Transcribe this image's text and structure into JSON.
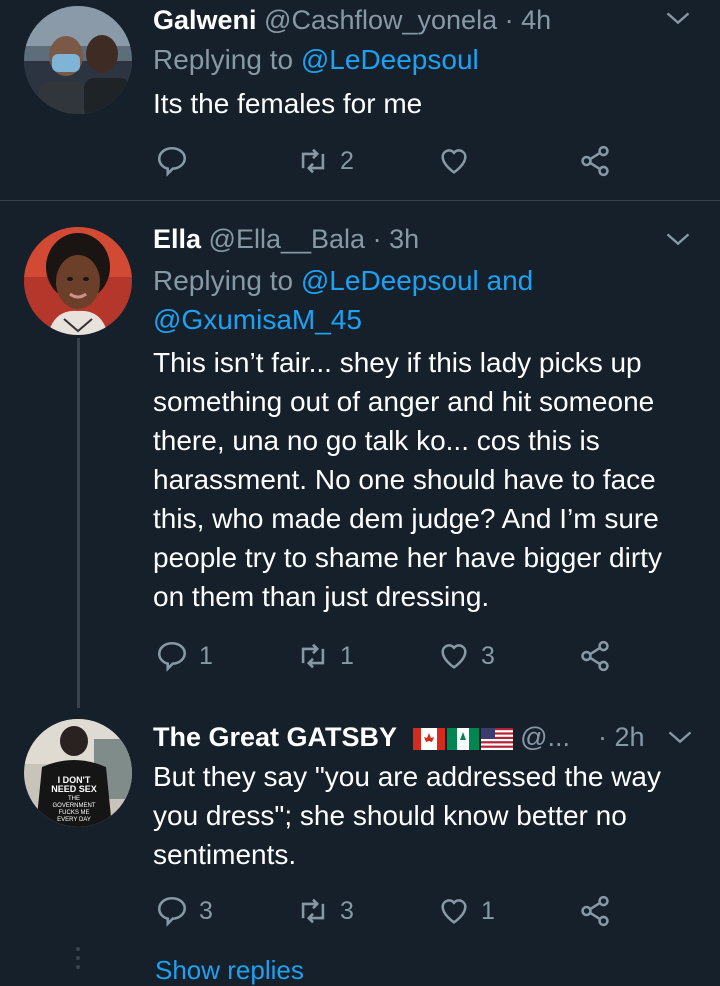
{
  "tweets": [
    {
      "name": "Galweni",
      "handle": "@Cashflow_yonela",
      "dot": "·",
      "time": "4h",
      "replying_prefix": "Replying to",
      "replying_line1": "@LeDeepsoul",
      "body": [
        "Its the females for me"
      ],
      "counts": {
        "reply": "",
        "retweet": "2",
        "like": ""
      }
    },
    {
      "name": "Ella",
      "handle": "@Ella__Bala",
      "dot": "·",
      "time": "3h",
      "replying_prefix": "Replying to",
      "replying_line1": "@LeDeepsoul and",
      "replying_line2": "@GxumisaM_45",
      "body": [
        "This isn’t fair... shey if this lady picks up",
        "something out of anger and hit someone",
        "there, una no go talk ko... cos this is",
        "harassment. No one should have to face",
        "this, who made dem judge? And I’m sure",
        "people try to shame her have bigger dirty",
        "on them than just dressing."
      ],
      "counts": {
        "reply": "1",
        "retweet": "1",
        "like": "3"
      }
    },
    {
      "name": "The Great GATSBY",
      "handle": "@...",
      "dot": "·",
      "time": "2h",
      "shirt_text": "I DON'T NEED SEX THE GOVERNMENT FUCKS ME EVERY DAY",
      "body": [
        "But they say \"you are addressed the way",
        "you dress\"; she should know better no",
        "sentiments."
      ],
      "counts": {
        "reply": "3",
        "retweet": "3",
        "like": "1"
      }
    }
  ],
  "show_replies": "Show replies",
  "icons": [
    "reply-icon",
    "retweet-icon",
    "like-icon",
    "share-icon",
    "chevron-down-icon"
  ],
  "colors": {
    "background": "#15202b",
    "text": "#ffffff",
    "muted": "#8899a6",
    "link": "#1da1f2",
    "divider": "#38444d"
  }
}
